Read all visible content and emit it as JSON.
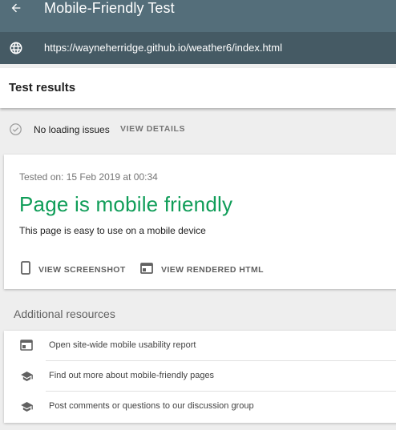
{
  "appbar": {
    "title": "Mobile-Friendly Test",
    "back_icon": "arrow-back-icon",
    "background": "#546e7a"
  },
  "urlbar": {
    "url": "https://wayneherridge.github.io/weather6/index.html",
    "icon": "globe-icon",
    "background": "#455a64"
  },
  "results": {
    "heading": "Test results"
  },
  "loading": {
    "status": "No loading issues",
    "details_label": "VIEW DETAILS",
    "icon": "check-circle-icon"
  },
  "card": {
    "tested_on": "Tested on: 15 Feb 2019 at 00:34",
    "verdict": "Page is mobile friendly",
    "verdict_color": "#0f9d58",
    "description": "This page is easy to use on a mobile device",
    "actions": [
      {
        "label": "VIEW SCREENSHOT",
        "icon": "phone-icon"
      },
      {
        "label": "VIEW RENDERED HTML",
        "icon": "browser-window-icon"
      }
    ]
  },
  "resources": {
    "title": "Additional resources",
    "items": [
      {
        "label": "Open site-wide mobile usability report",
        "icon": "browser-window-icon"
      },
      {
        "label": "Find out more about mobile-friendly pages",
        "icon": "school-icon"
      },
      {
        "label": "Post comments or questions to our discussion group",
        "icon": "school-icon"
      }
    ]
  }
}
